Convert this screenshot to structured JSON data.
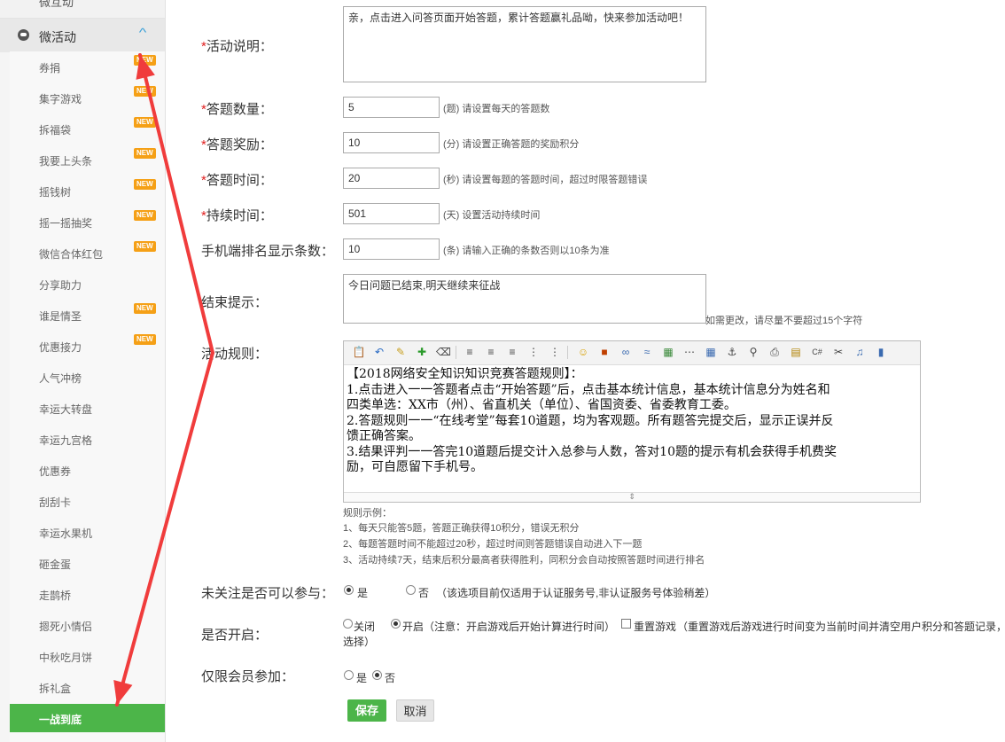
{
  "sidebar": {
    "cut_label": "微互动",
    "group_label": "微活动",
    "new_badge": "NEW",
    "items": [
      {
        "label": "券捐",
        "new": true
      },
      {
        "label": "集字游戏",
        "new": true
      },
      {
        "label": "拆福袋",
        "new": true
      },
      {
        "label": "我要上头条",
        "new": true
      },
      {
        "label": "摇钱树",
        "new": true
      },
      {
        "label": "摇一摇抽奖",
        "new": true
      },
      {
        "label": "微信合体红包",
        "new": true
      },
      {
        "label": "分享助力",
        "new": false
      },
      {
        "label": "谁是情圣",
        "new": true
      },
      {
        "label": "优惠接力",
        "new": true
      },
      {
        "label": "人气冲榜",
        "new": false
      },
      {
        "label": "幸运大转盘",
        "new": false
      },
      {
        "label": "幸运九宫格",
        "new": false
      },
      {
        "label": "优惠券",
        "new": false
      },
      {
        "label": "刮刮卡",
        "new": false
      },
      {
        "label": "幸运水果机",
        "new": false
      },
      {
        "label": "砸金蛋",
        "new": false
      },
      {
        "label": "走鹊桥",
        "new": false
      },
      {
        "label": "摁死小情侣",
        "new": false
      },
      {
        "label": "中秋吃月饼",
        "new": false
      },
      {
        "label": "拆礼盒",
        "new": false
      },
      {
        "label": "一战到底",
        "new": false,
        "active": true
      }
    ]
  },
  "form": {
    "required_mark": "*",
    "desc": {
      "label": "活动说明：",
      "value": "亲，点击进入问答页面开始答题，累计答题赢礼品呦，快来参加活动吧！"
    },
    "count": {
      "label": "答题数量：",
      "value": "5",
      "hint": "(题) 请设置每天的答题数"
    },
    "reward": {
      "label": "答题奖励：",
      "value": "10",
      "hint": "(分) 请设置正确答题的奖励积分"
    },
    "time": {
      "label": "答题时间：",
      "value": "20",
      "hint": "(秒) 请设置每题的答题时间，超过时限答题错误"
    },
    "duration": {
      "label": "持续时间：",
      "value": "501",
      "hint": "(天) 设置活动持续时间"
    },
    "ranking": {
      "label": "手机端排名显示条数：",
      "value": "10",
      "hint": "(条) 请输入正确的条数否则以10条为准"
    },
    "end_tip": {
      "label": "结束提示：",
      "value": "今日问题已结束,明天继续来征战",
      "hint": "如需更改，请尽量不要超过15个字符"
    },
    "rules": {
      "label": "活动规则：",
      "content_lines": [
        "【2018网络安全知识知识竞赛答题规则】：",
        "1.点击进入一一答题者点击“开始答题”后，点击基本统计信息，基本统计信息分为姓名和",
        "四类单选：XX市（州）、省直机关（单位）、省国资委、省委教育工委。",
        "2.答题规则一一“在线考堂”每套10道题，均为客观题。所有题答完提交后，显示正误并反",
        "馈正确答案。",
        "3.结果评判一一答完10道题后提交计入总参与人数，答对10题的提示有机会获得手机费奖",
        "励，可自愿留下手机号。"
      ],
      "example_title": "规则示例：",
      "example_lines": [
        "1、每天只能答5题，答题正确获得10积分，错误无积分",
        "2、每题答题时间不能超过20秒，超过时间则答题错误自动进入下一题",
        "3、活动持续7天，结束后积分最高者获得胜利，同积分会自动按照答题时间进行排名"
      ]
    },
    "follow": {
      "label": "未关注是否可以参与：",
      "yes": "是",
      "no": "否",
      "selected": "是",
      "note": "（该选项目前仅适用于认证服务号,非认证服务号体验稍差）"
    },
    "enable": {
      "label": "是否开启：",
      "off": "关闭",
      "on": "开启",
      "selected": "开启",
      "note": "（注意：开启游戏后开始计算进行时间）",
      "reset_label": "重置游戏",
      "reset_note": "（重置游戏后游戏进行时间变为当前时间并清空用户积分和答题记录，",
      "reset_note2": "选择）"
    },
    "member": {
      "label": "仅限会员参加：",
      "yes": "是",
      "no": "否",
      "selected": "否"
    },
    "buttons": {
      "save": "保存",
      "cancel": "取消"
    }
  },
  "annotation_color": "#f03c3c"
}
